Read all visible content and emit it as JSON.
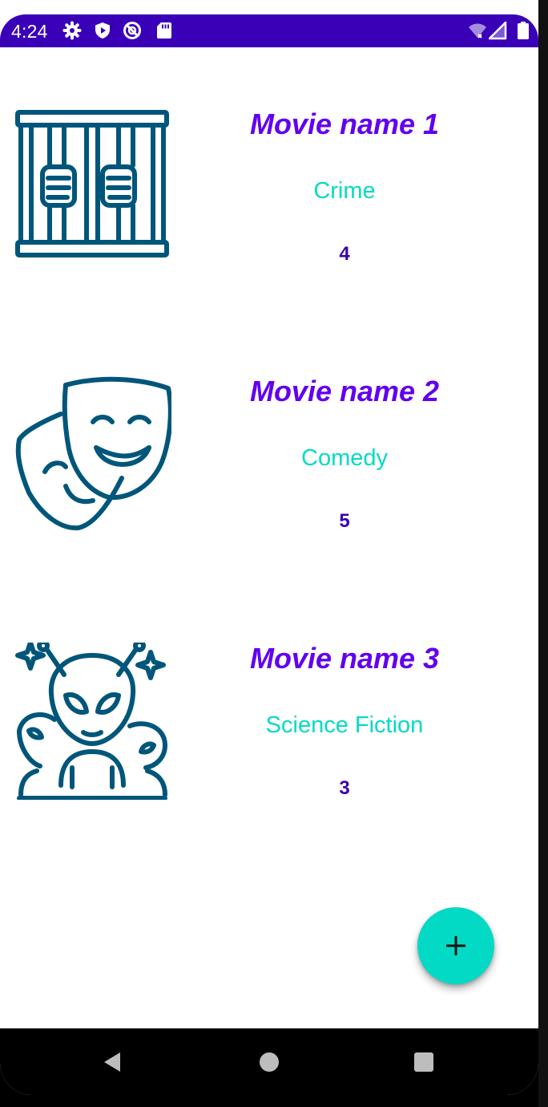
{
  "status_bar": {
    "time": "4:24",
    "icons": [
      "gear-icon",
      "shield-play-icon",
      "vpn-icon",
      "sd-card-icon",
      "wifi-icon",
      "signal-icon",
      "battery-icon"
    ],
    "background": "#3a00b8"
  },
  "movies": [
    {
      "title": "Movie name 1",
      "genre": "Crime",
      "rating": "4",
      "icon": "prison-bars-icon"
    },
    {
      "title": "Movie name 2",
      "genre": "Comedy",
      "rating": "5",
      "icon": "theater-masks-icon"
    },
    {
      "title": "Movie name 3",
      "genre": "Science Fiction",
      "rating": "3",
      "icon": "aliens-icon"
    }
  ],
  "fab": {
    "icon": "plus-icon",
    "color": "#03dac5"
  },
  "navigation": {
    "buttons": [
      "back-icon",
      "home-icon",
      "recents-icon"
    ]
  },
  "colors": {
    "title": "#6200ee",
    "genre": "#03dac5",
    "rating": "#3700b3",
    "icon_stroke": "#00567a"
  }
}
